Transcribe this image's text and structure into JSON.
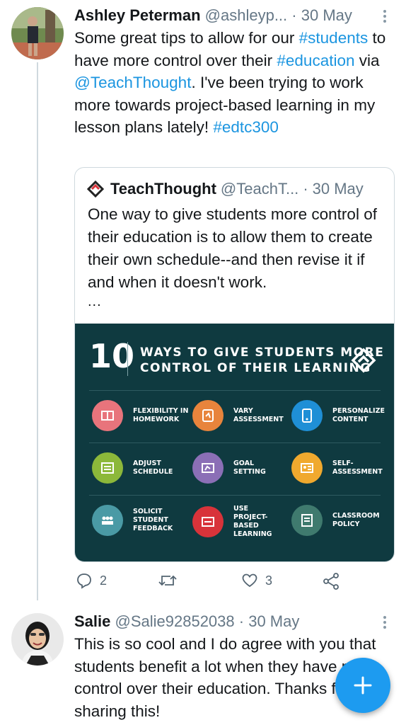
{
  "tweet1": {
    "name": "Ashley Peterman",
    "handle": "@ashleyp...",
    "separator": "·",
    "date": "30 May",
    "text_parts": {
      "p1": "Some great tips to allow for our ",
      "tag1": "#students",
      "p2": " to have more control over their ",
      "tag2": "#education",
      "p3": " via ",
      "mention": "@TeachThought",
      "p4": ". I've been trying to work more towards project-based learning in my lesson plans lately! ",
      "tag3": "#edtc300"
    },
    "quote": {
      "name": "TeachThought",
      "handle": "@TeachT...",
      "separator": "·",
      "date": "30 May",
      "text": "One way to give students more control of their education is to allow them to create their own schedule--and then revise it if and when it doesn't work.",
      "ellipsis": "...",
      "infographic": {
        "number": "10",
        "title_line1": "WAYS TO GIVE STUDENTS MORE",
        "title_line2": "CONTROL OF THEIR LEARNING",
        "items": [
          {
            "label": "FLEXIBILITY IN\nHOMEWORK",
            "color": "#e8747c"
          },
          {
            "label": "VARY\nASSESSMENT",
            "color": "#e8843c"
          },
          {
            "label": "PERSONALIZE\nCONTENT",
            "color": "#1f8fd6"
          },
          {
            "label": "ADJUST\nSCHEDULE",
            "color": "#8cb83a"
          },
          {
            "label": "GOAL\nSETTING",
            "color": "#8b6fb6"
          },
          {
            "label": "SELF-\nASSESSMENT",
            "color": "#f0a92e"
          },
          {
            "label": "SOLICIT\nSTUDENT\nFEEDBACK",
            "color": "#4a9aa5"
          },
          {
            "label": "USE\nPROJECT-\nBASED\nLEARNING",
            "color": "#d8333a"
          },
          {
            "label": "CLASSROOM\nPOLICY",
            "color": "#3f7a6e"
          }
        ]
      }
    },
    "actions": {
      "reply_count": "2",
      "retweet_count": "",
      "like_count": "3"
    }
  },
  "tweet2": {
    "name": "Salie",
    "handle": "@Salie92852038",
    "separator": "·",
    "date": "30 May",
    "text": "This is so cool and I do agree with you that students benefit a lot when they have more control over their education. Thanks for sharing this!"
  },
  "colors": {
    "link": "#1b95e0",
    "fab": "#1d9bf0",
    "infographic_bg": "#0f3a40"
  },
  "icons": {
    "more": "more-vertical-icon",
    "reply": "reply-icon",
    "retweet": "retweet-icon",
    "like": "heart-icon",
    "share": "share-icon",
    "compose": "plus-icon"
  }
}
